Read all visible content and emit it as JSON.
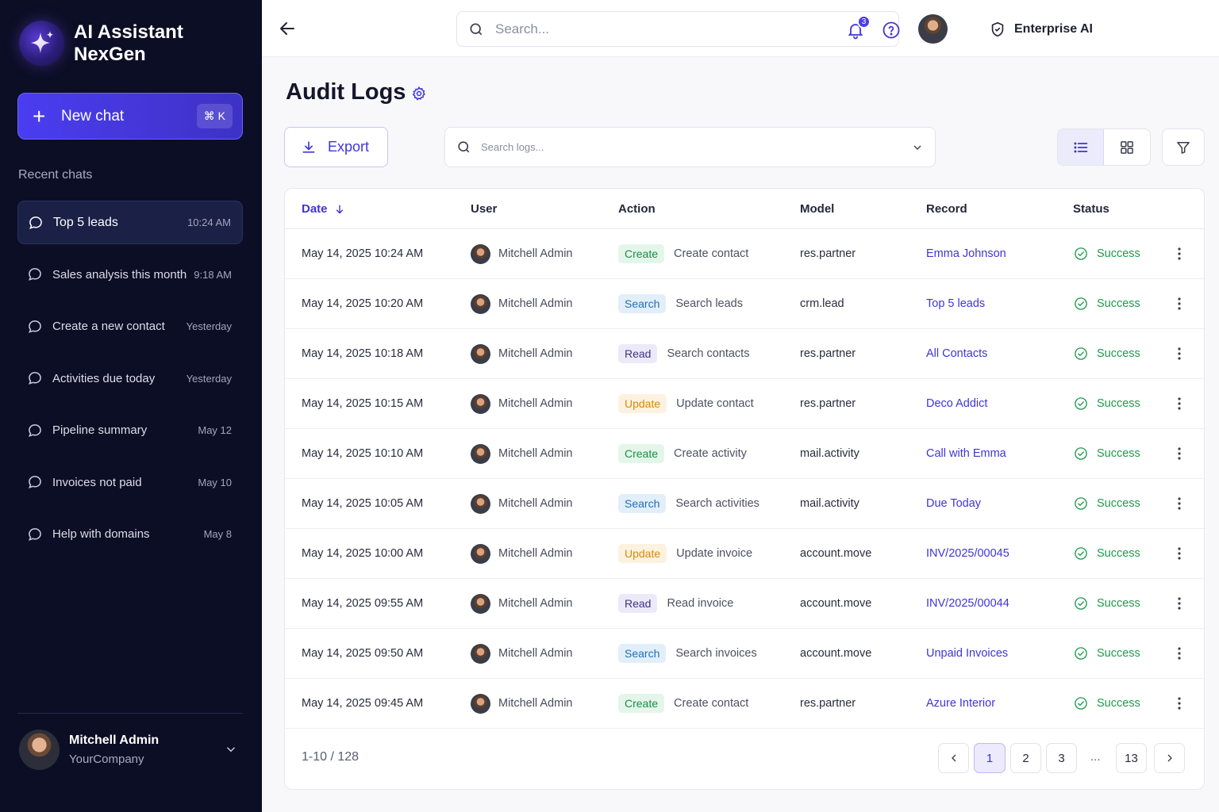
{
  "brand": {
    "line1": "AI Assistant",
    "line2": "NexGen"
  },
  "sidebar": {
    "new_chat_label": "New chat",
    "new_chat_shortcut": "⌘ K",
    "recent_title": "Recent chats",
    "chats": [
      {
        "title": "Top 5 leads",
        "time": "10:24 AM"
      },
      {
        "title": "Sales analysis this month",
        "time": "9:18 AM"
      },
      {
        "title": "Create a new contact",
        "time": "Yesterday"
      },
      {
        "title": "Activities due today",
        "time": "Yesterday"
      },
      {
        "title": "Pipeline summary",
        "time": "May 12"
      },
      {
        "title": "Invoices not paid",
        "time": "May 10"
      },
      {
        "title": "Help with domains",
        "time": "May 8"
      }
    ],
    "user": {
      "name": "Mitchell Admin",
      "company": "YourCompany"
    }
  },
  "topbar": {
    "search_placeholder": "Search...",
    "workspace": "Enterprise AI",
    "notification_count": "3"
  },
  "page": {
    "title": "Audit Logs",
    "export_label": "Export",
    "log_search_placeholder": "Search logs..."
  },
  "table": {
    "headers": {
      "date": "Date",
      "user": "User",
      "action": "Action",
      "model": "Model",
      "record": "Record",
      "status": "Status"
    },
    "rows": [
      {
        "date": "May 14, 2025 10:24 AM",
        "user": "Mitchell Admin",
        "action_type": "Create",
        "action_desc": "Create contact",
        "model": "res.partner",
        "record": "Emma Johnson",
        "status": "Success"
      },
      {
        "date": "May 14, 2025 10:20 AM",
        "user": "Mitchell Admin",
        "action_type": "Search",
        "action_desc": "Search leads",
        "model": "crm.lead",
        "record": "Top 5 leads",
        "status": "Success"
      },
      {
        "date": "May 14, 2025 10:18 AM",
        "user": "Mitchell Admin",
        "action_type": "Read",
        "action_desc": "Search contacts",
        "model": "res.partner",
        "record": "All Contacts",
        "status": "Success"
      },
      {
        "date": "May 14, 2025 10:15 AM",
        "user": "Mitchell Admin",
        "action_type": "Update",
        "action_desc": "Update contact",
        "model": "res.partner",
        "record": "Deco Addict",
        "status": "Success"
      },
      {
        "date": "May 14, 2025 10:10 AM",
        "user": "Mitchell Admin",
        "action_type": "Create",
        "action_desc": "Create activity",
        "model": "mail.activity",
        "record": "Call with Emma",
        "status": "Success"
      },
      {
        "date": "May 14, 2025 10:05 AM",
        "user": "Mitchell Admin",
        "action_type": "Search",
        "action_desc": "Search activities",
        "model": "mail.activity",
        "record": "Due Today",
        "status": "Success"
      },
      {
        "date": "May 14, 2025 10:00 AM",
        "user": "Mitchell Admin",
        "action_type": "Update",
        "action_desc": "Update invoice",
        "model": "account.move",
        "record": "INV/2025/00045",
        "status": "Success"
      },
      {
        "date": "May 14, 2025 09:55 AM",
        "user": "Mitchell Admin",
        "action_type": "Read",
        "action_desc": "Read invoice",
        "model": "account.move",
        "record": "INV/2025/00044",
        "status": "Success"
      },
      {
        "date": "May 14, 2025 09:50 AM",
        "user": "Mitchell Admin",
        "action_type": "Search",
        "action_desc": "Search invoices",
        "model": "account.move",
        "record": "Unpaid Invoices",
        "status": "Success"
      },
      {
        "date": "May 14, 2025 09:45 AM",
        "user": "Mitchell Admin",
        "action_type": "Create",
        "action_desc": "Create contact",
        "model": "res.partner",
        "record": "Azure Interior",
        "status": "Success"
      }
    ]
  },
  "pagination": {
    "info": "1-10 / 128",
    "pages": [
      "1",
      "2",
      "3",
      "13"
    ],
    "ellipsis": "...",
    "current": "1"
  },
  "colors": {
    "accent": "#3f35d8",
    "sidebar_bg": "#0c0e25",
    "success": "#1e9a4c",
    "create": "#1b8d45",
    "search": "#1f6fb8",
    "read": "#3c3487",
    "update": "#d88a09"
  },
  "icons": {
    "brand": "sparkle-icon",
    "back": "arrow-left-icon",
    "search": "search-icon",
    "workspace": "shield-check-icon",
    "notifications": "bell-icon",
    "help": "help-circle-icon",
    "settings": "gear-icon",
    "export": "download-icon",
    "dropdown": "chevron-down-icon",
    "list_view": "list-icon",
    "grid_view": "grid-icon",
    "filter": "filter-icon",
    "chat": "chat-bubble-icon",
    "status": "check-circle-icon",
    "row_menu": "kebab-icon"
  }
}
